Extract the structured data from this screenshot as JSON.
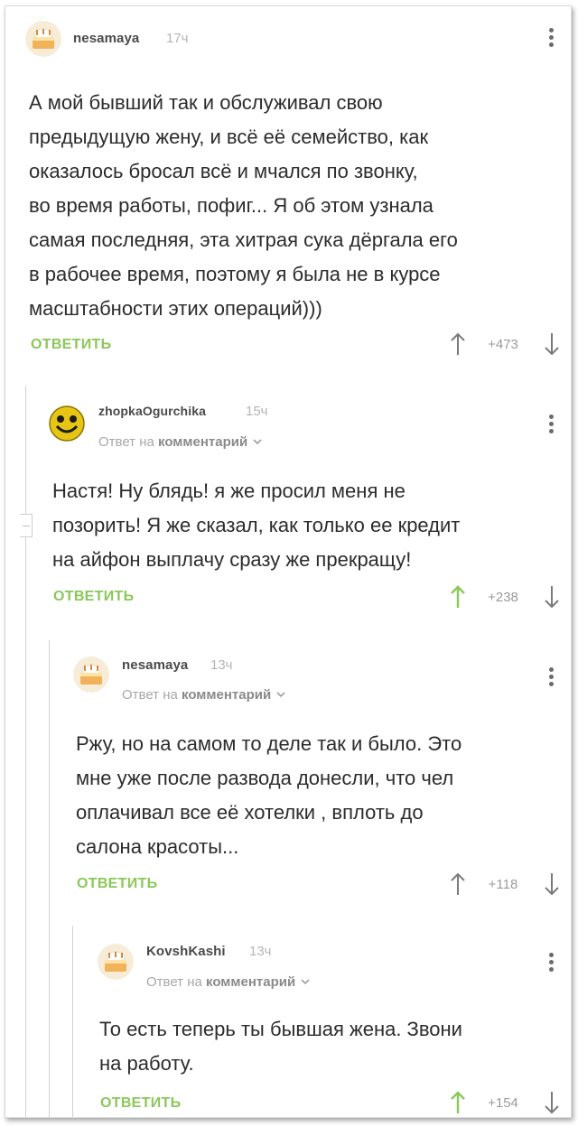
{
  "colors": {
    "accent_green": "#8ac858",
    "text": "#2c2c2c",
    "username": "#4a4a4a",
    "muted": "#b5b5b5"
  },
  "comments": [
    {
      "username": "nesamaya",
      "time": "17ч",
      "avatar_icon": "cake-avatar-icon",
      "reply_to": null,
      "lines": [
        "А мой бывший так и обслуживал свою",
        "предыдущую жену, и всё её семейство, как",
        "оказалось бросал всё и мчался по звонку,",
        "во время работы, пофиг... Я об этом узнала",
        "самая последняя, эта хитрая сука дёргала  его",
        "в рабочее время, поэтому я была не в курсе",
        "масштабности этих операций)))"
      ],
      "reply_label": "ОТВЕТИТЬ",
      "score": "+473",
      "upvoted": false
    },
    {
      "username": "zhopkaOgurchika",
      "time": "15ч",
      "avatar_icon": "smiley-avatar-icon",
      "reply_to": {
        "prefix": "Ответ на",
        "target": "комментарий"
      },
      "lines": [
        "Настя! Ну блядь! я же просил меня не",
        "позорить! Я же сказал, как только ее кредит",
        "на айфон выплачу сразу же прекращу!"
      ],
      "reply_label": "ОТВЕТИТЬ",
      "score": "+238",
      "upvoted": true
    },
    {
      "username": "nesamaya",
      "time": "13ч",
      "avatar_icon": "cake-avatar-icon",
      "reply_to": {
        "prefix": "Ответ на",
        "target": "комментарий"
      },
      "lines": [
        "Ржу, но на самом то деле так и было. Это",
        "мне уже после развода донесли, что чел",
        "оплачивал все её хотелки , вплоть до",
        "салона красоты..."
      ],
      "reply_label": "ОТВЕТИТЬ",
      "score": "+118",
      "upvoted": false
    },
    {
      "username": "KovshKashi",
      "time": "13ч",
      "avatar_icon": "cake-avatar-icon",
      "reply_to": {
        "prefix": "Ответ на",
        "target": "комментарий"
      },
      "lines": [
        "То есть теперь ты бывшая жена. Звони",
        "на работу."
      ],
      "reply_label": "ОТВЕТИТЬ",
      "score": "+154",
      "upvoted": true
    }
  ]
}
